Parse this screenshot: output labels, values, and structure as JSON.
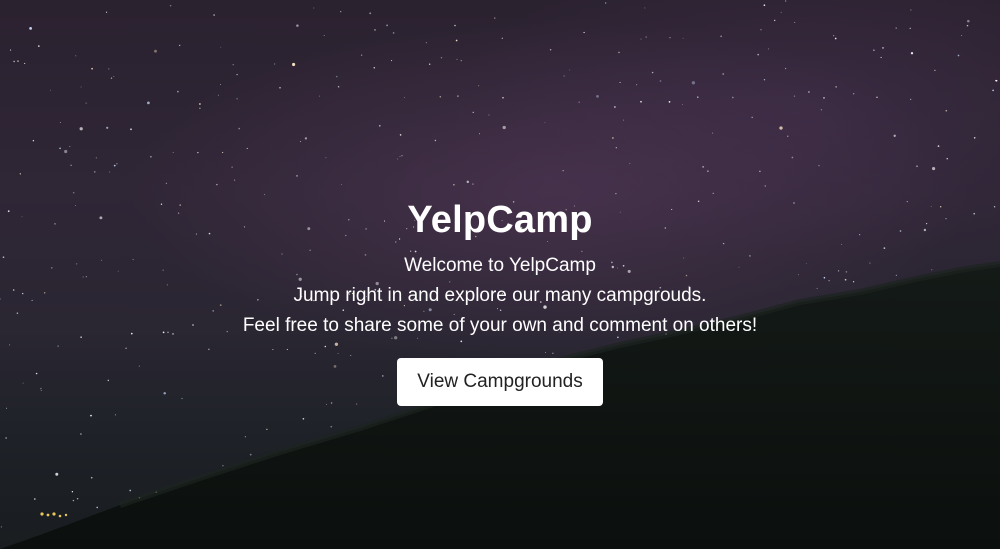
{
  "hero": {
    "title": "YelpCamp",
    "lines": [
      "Welcome to YelpCamp",
      "Jump right in and explore our many campgrouds.",
      "Feel free to share some of your own and comment on others!"
    ],
    "button_label": "View Campgrounds"
  },
  "colors": {
    "sky": "#2b2230",
    "hill": "#0f1512",
    "text": "#ffffff",
    "button_bg": "#ffffff",
    "button_text": "#222222"
  }
}
